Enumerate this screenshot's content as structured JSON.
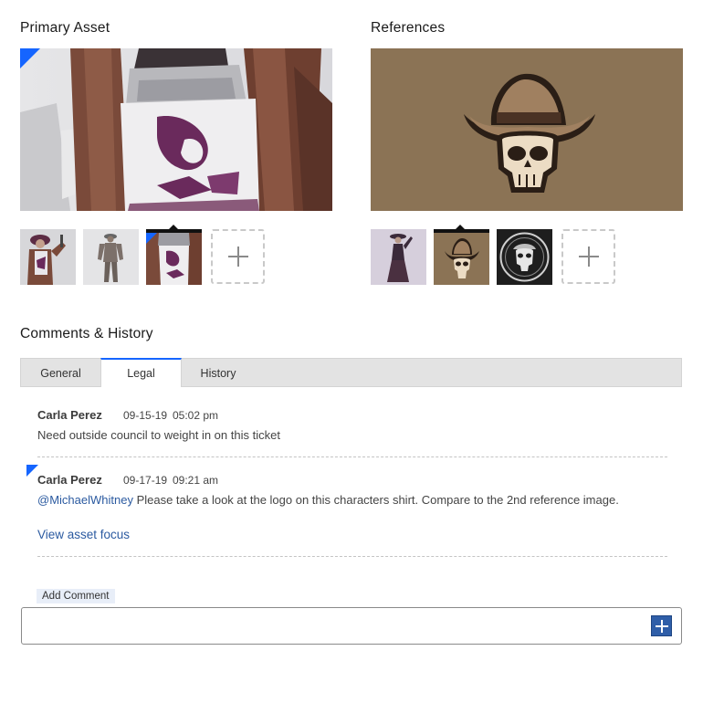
{
  "primary": {
    "title": "Primary Asset",
    "thumbnails": [
      "character-front",
      "character-3d-model",
      "character-shirt-closeup"
    ],
    "selected_index": 2
  },
  "references": {
    "title": "References",
    "thumbnails": [
      "character-reference-poster",
      "cowboy-skull-logo",
      "skull-emblem-dark"
    ],
    "selected_index": 1
  },
  "comments": {
    "title": "Comments & History",
    "tabs": [
      "General",
      "Legal",
      "History"
    ],
    "active_tab": "Legal",
    "items": [
      {
        "author": "Carla Perez",
        "date": "09-15-19",
        "time": "05:02 pm",
        "text": "Need outside council to weight in on this ticket"
      },
      {
        "author": "Carla Perez",
        "date": "09-17-19",
        "time": "09:21 am",
        "mention": "@MichaelWhitney",
        "text": " Please take a look at the logo on this characters shirt. Compare to the 2nd reference image.",
        "link": "View asset focus"
      }
    ]
  },
  "add_comment": {
    "label": "Add Comment",
    "value": ""
  },
  "colors": {
    "accent_blue": "#1565ff",
    "link_blue": "#2b5aa0",
    "button_blue": "#2f5ea8",
    "logo_background": "#8b7355"
  }
}
